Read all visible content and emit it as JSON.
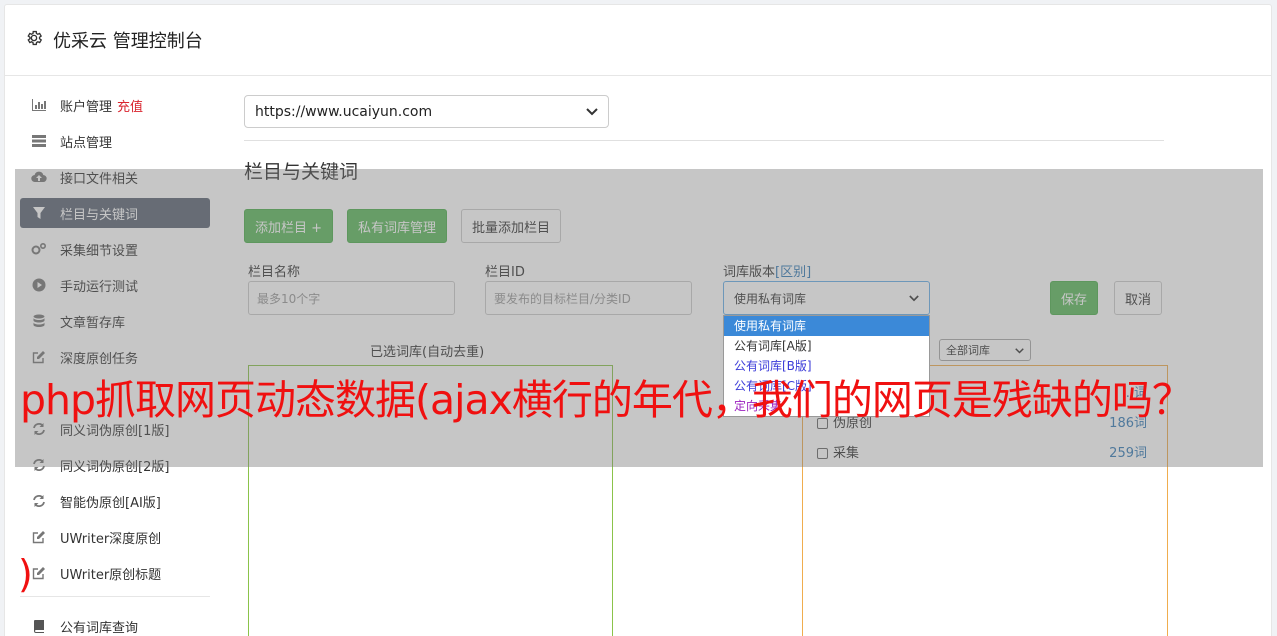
{
  "header": {
    "title": "优采云 管理控制台",
    "icon": "gear-icon"
  },
  "sidebar": {
    "items": [
      {
        "label": "账户管理",
        "extra": "充值",
        "icon": "bar-chart-icon"
      },
      {
        "label": "站点管理",
        "icon": "server-icon"
      },
      {
        "label": "接口文件相关",
        "icon": "cloud-upload-icon"
      },
      {
        "label": "栏目与关键词",
        "icon": "filter-icon",
        "active": true
      },
      {
        "label": "采集细节设置",
        "icon": "gears-icon"
      },
      {
        "label": "手动运行测试",
        "icon": "play-circle-icon"
      },
      {
        "label": "文章暂存库",
        "icon": "database-icon"
      },
      {
        "label": "深度原创任务",
        "icon": "edit-icon"
      },
      {
        "label": "",
        "icon": ""
      },
      {
        "label": "同义词伪原创[1版]",
        "icon": "refresh-icon"
      },
      {
        "label": "同义词伪原创[2版]",
        "icon": "refresh-icon"
      },
      {
        "label": "智能伪原创[AI版]",
        "icon": "refresh-icon"
      },
      {
        "label": "UWriter深度原创",
        "icon": "edit-icon"
      },
      {
        "label": "UWriter原创标题",
        "icon": "edit-icon"
      }
    ],
    "bottom_item": {
      "label": "公有词库查询",
      "icon": "book-icon"
    }
  },
  "main": {
    "site_select": "https://www.ucaiyun.com",
    "section_title": "栏目与关键词",
    "buttons": {
      "add_column": "添加栏目 +",
      "private_lib": "私有词库管理",
      "batch_add": "批量添加栏目"
    },
    "form": {
      "name_label": "栏目名称",
      "name_placeholder": "最多10个字",
      "id_label": "栏目ID",
      "id_placeholder": "要发布的目标栏目/分类ID",
      "version_label": "词库版本",
      "version_link": "[区别]",
      "version_value": "使用私有词库",
      "save": "保存",
      "cancel": "取消"
    },
    "selected_label": "已选词库(自动去重)",
    "filter_select": "全部词库",
    "dropdown_options": [
      "使用私有词库",
      "公有词库[A版]",
      "公有词库[B版]",
      "公有词库[C版]",
      "定向采集"
    ],
    "libraries": [
      {
        "name": "",
        "count": "...词"
      },
      {
        "name": "伪原创",
        "count": "186词"
      },
      {
        "name": "采集",
        "count": "259词"
      }
    ]
  },
  "overlay_text": {
    "headline": "php抓取网页动态数据(ajax横行的年代，我们的网页是残缺的吗？",
    "paren": ")"
  },
  "colors": {
    "accent_green": "#5cb85c",
    "active_nav": "#5c6574",
    "headline_red": "#f01010",
    "recharge_red": "#d9232d"
  }
}
